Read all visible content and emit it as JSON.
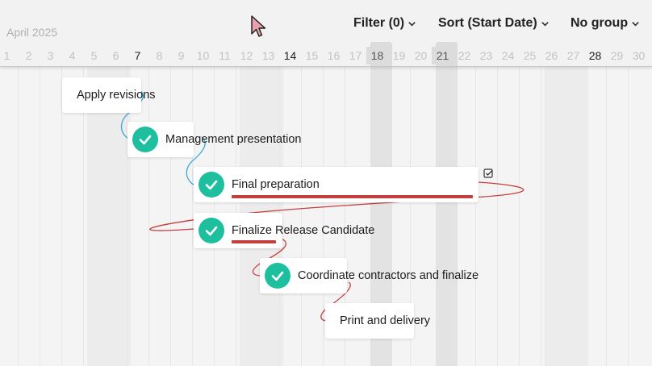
{
  "header": {
    "month_label": "April 2025",
    "filter_label": "Filter (0)",
    "sort_label": "Sort (Start Date)",
    "group_label": "No group",
    "days": [
      "1",
      "2",
      "3",
      "4",
      "5",
      "6",
      "7",
      "8",
      "9",
      "10",
      "11",
      "12",
      "13",
      "14",
      "15",
      "16",
      "17",
      "18",
      "19",
      "20",
      "21",
      "22",
      "23",
      "24",
      "25",
      "26",
      "27",
      "28",
      "29",
      "30"
    ],
    "highlighted_days": [
      "18",
      "21"
    ],
    "emphasized_days": [
      "7",
      "14",
      "28"
    ]
  },
  "tasks": [
    {
      "label": "Apply revisions",
      "completed": false
    },
    {
      "label": "Management presentation",
      "completed": true
    },
    {
      "label": "Final preparation",
      "completed": true
    },
    {
      "label": "Finalize Release Candidate",
      "completed": true
    },
    {
      "label": "Coordinate contractors and finalize",
      "completed": true
    },
    {
      "label": "Print and delivery",
      "completed": false
    }
  ],
  "colors": {
    "check_green": "#1dbf9e",
    "link_blue": "#3aa8d8",
    "link_red": "#c53f3f"
  },
  "icons": {
    "toolbar_chevron": "chevron-down-icon",
    "task_complete": "check-circle-icon",
    "selection_indicator": "checkbox-icon",
    "pointer": "mouse-cursor-icon"
  }
}
